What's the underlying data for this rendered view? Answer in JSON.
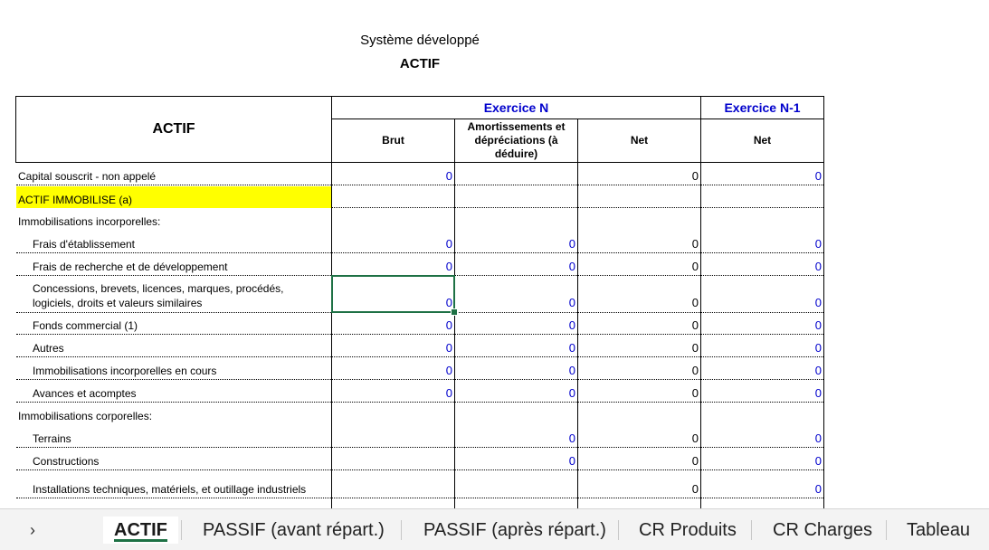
{
  "sheet": {
    "title": "Système développé",
    "subtitle": "ACTIF",
    "header": {
      "main": "ACTIF",
      "exercice_n": "Exercice N",
      "exercice_n1": "Exercice N-1",
      "brut": "Brut",
      "amort": "Amortissements et dépréciations (à déduire)",
      "net": "Net",
      "net_n1": "Net"
    },
    "rows": [
      {
        "label": "Capital souscrit - non appelé",
        "brut": "0",
        "amort": "",
        "net": "0",
        "n1": "0"
      },
      {
        "label": "ACTIF IMMOBILISE (a)",
        "brut": "",
        "amort": "",
        "net": "",
        "n1": ""
      },
      {
        "label": "Immobilisations incorporelles:",
        "brut": "",
        "amort": "",
        "net": "",
        "n1": ""
      },
      {
        "label": "Frais d'établissement",
        "brut": "0",
        "amort": "0",
        "net": "0",
        "n1": "0"
      },
      {
        "label": "Frais de recherche et de développement",
        "brut": "0",
        "amort": "0",
        "net": "0",
        "n1": "0"
      },
      {
        "label": "Concessions, brevets, licences, marques, procédés, logiciels, droits et valeurs similaires",
        "brut": "0",
        "amort": "0",
        "net": "0",
        "n1": "0"
      },
      {
        "label": "Fonds commercial (1)",
        "brut": "0",
        "amort": "0",
        "net": "0",
        "n1": "0"
      },
      {
        "label": "Autres",
        "brut": "0",
        "amort": "0",
        "net": "0",
        "n1": "0"
      },
      {
        "label": "Immobilisations incorporelles en cours",
        "brut": "0",
        "amort": "0",
        "net": "0",
        "n1": "0"
      },
      {
        "label": "Avances et acomptes",
        "brut": "0",
        "amort": "0",
        "net": "0",
        "n1": "0"
      },
      {
        "label": "Immobilisations corporelles:",
        "brut": "",
        "amort": "",
        "net": "",
        "n1": ""
      },
      {
        "label": "Terrains",
        "brut": "",
        "amort": "0",
        "net": "0",
        "n1": "0"
      },
      {
        "label": "Constructions",
        "brut": "",
        "amort": "0",
        "net": "0",
        "n1": "0"
      },
      {
        "label": "Installations techniques, matériels, et outillage industriels",
        "brut": "",
        "amort": "",
        "net": "0",
        "n1": "0"
      }
    ]
  },
  "tabs": [
    {
      "label": "ACTIF",
      "active": true
    },
    {
      "label": "PASSIF (avant répart.)",
      "active": false
    },
    {
      "label": "PASSIF (après répart.)",
      "active": false
    },
    {
      "label": "CR Produits",
      "active": false
    },
    {
      "label": "CR Charges",
      "active": false
    },
    {
      "label": "Tableau",
      "active": false
    }
  ],
  "colors": {
    "accent": "#1e7145",
    "value_blue": "#0000cc",
    "highlight": "#ffff00"
  }
}
